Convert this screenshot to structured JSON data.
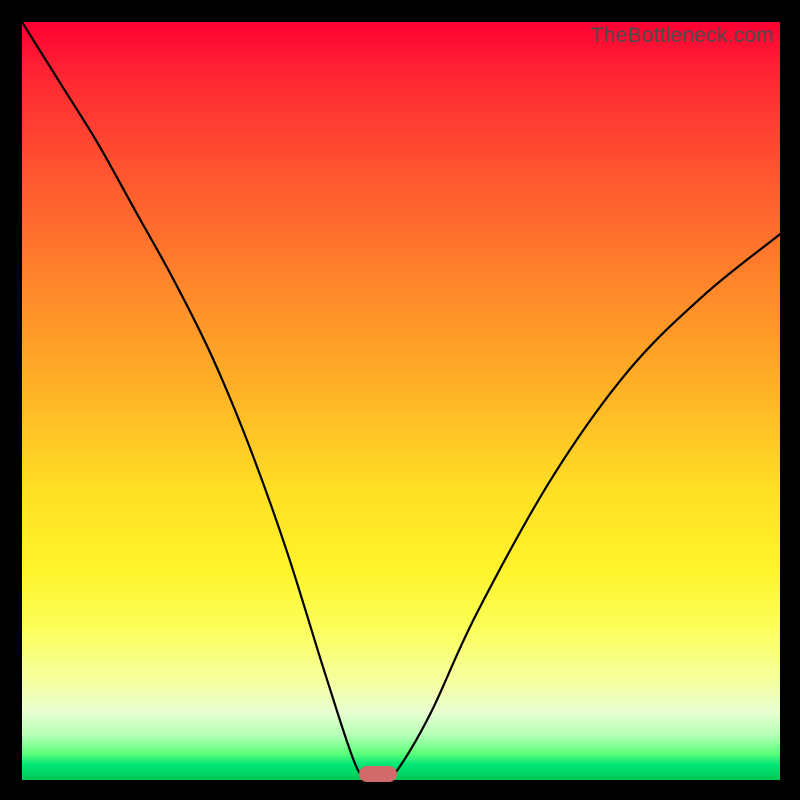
{
  "watermark": "TheBottleneck.com",
  "chart_data": {
    "type": "line",
    "title": "",
    "xlabel": "",
    "ylabel": "",
    "xlim": [
      0,
      100
    ],
    "ylim": [
      0,
      100
    ],
    "grid": false,
    "legend": false,
    "annotations": [],
    "series": [
      {
        "name": "bottleneck-curve",
        "x": [
          0,
          5,
          10,
          15,
          20,
          25,
          30,
          35,
          40,
          44,
          46,
          48,
          50,
          54,
          60,
          70,
          80,
          90,
          100
        ],
        "values": [
          100,
          92,
          84,
          75,
          66,
          56,
          44,
          30,
          14,
          2,
          0,
          0,
          2,
          9,
          22,
          40,
          54,
          64,
          72
        ]
      }
    ],
    "marker": {
      "x": 47,
      "y": 0,
      "color": "#d16a6a"
    },
    "gradient_stops": [
      {
        "pos": 0.0,
        "color": "#ff0033"
      },
      {
        "pos": 0.5,
        "color": "#ffb726"
      },
      {
        "pos": 0.8,
        "color": "#fcff5a"
      },
      {
        "pos": 0.97,
        "color": "#00e676"
      },
      {
        "pos": 1.0,
        "color": "#00c853"
      }
    ]
  }
}
